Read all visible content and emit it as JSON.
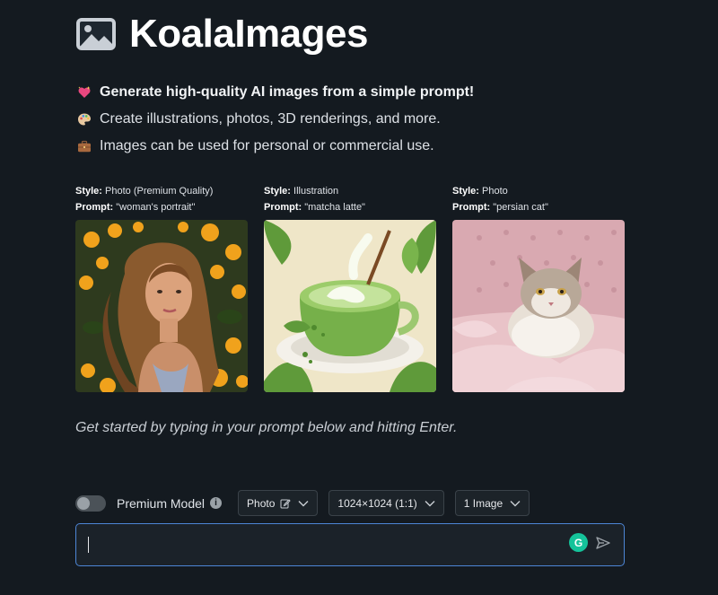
{
  "app": {
    "brand": "KoalaImages"
  },
  "features": [
    {
      "icon": "sparkling-heart-icon",
      "text": "Generate high-quality AI images from a simple prompt!",
      "bold": true
    },
    {
      "icon": "artist-palette-icon",
      "text": "Create illustrations, photos, 3D renderings, and more.",
      "bold": false
    },
    {
      "icon": "briefcase-icon",
      "text": "Images can be used for personal or commercial use.",
      "bold": false
    }
  ],
  "examples": [
    {
      "style_label": "Style:",
      "style": "Photo (Premium Quality)",
      "prompt_label": "Prompt:",
      "prompt": "\"woman's portrait\"",
      "image": "woman-portrait-image"
    },
    {
      "style_label": "Style:",
      "style": "Illustration",
      "prompt_label": "Prompt:",
      "prompt": "\"matcha latte\"",
      "image": "matcha-latte-image"
    },
    {
      "style_label": "Style:",
      "style": "Photo",
      "prompt_label": "Prompt:",
      "prompt": "\"persian cat\"",
      "image": "persian-cat-image"
    }
  ],
  "hint": "Get started by typing in your prompt below and hitting Enter.",
  "controls": {
    "premium_label": "Premium Model",
    "premium_enabled": false,
    "info_icon": "i",
    "style_select": "Photo",
    "size_select": "1024×1024 (1:1)",
    "count_select": "1 Image"
  },
  "prompt": {
    "value": "",
    "grammarly_label": "G"
  },
  "colors": {
    "background": "#141a20",
    "input_border": "#4d86d6",
    "grammarly": "#15c39a"
  }
}
